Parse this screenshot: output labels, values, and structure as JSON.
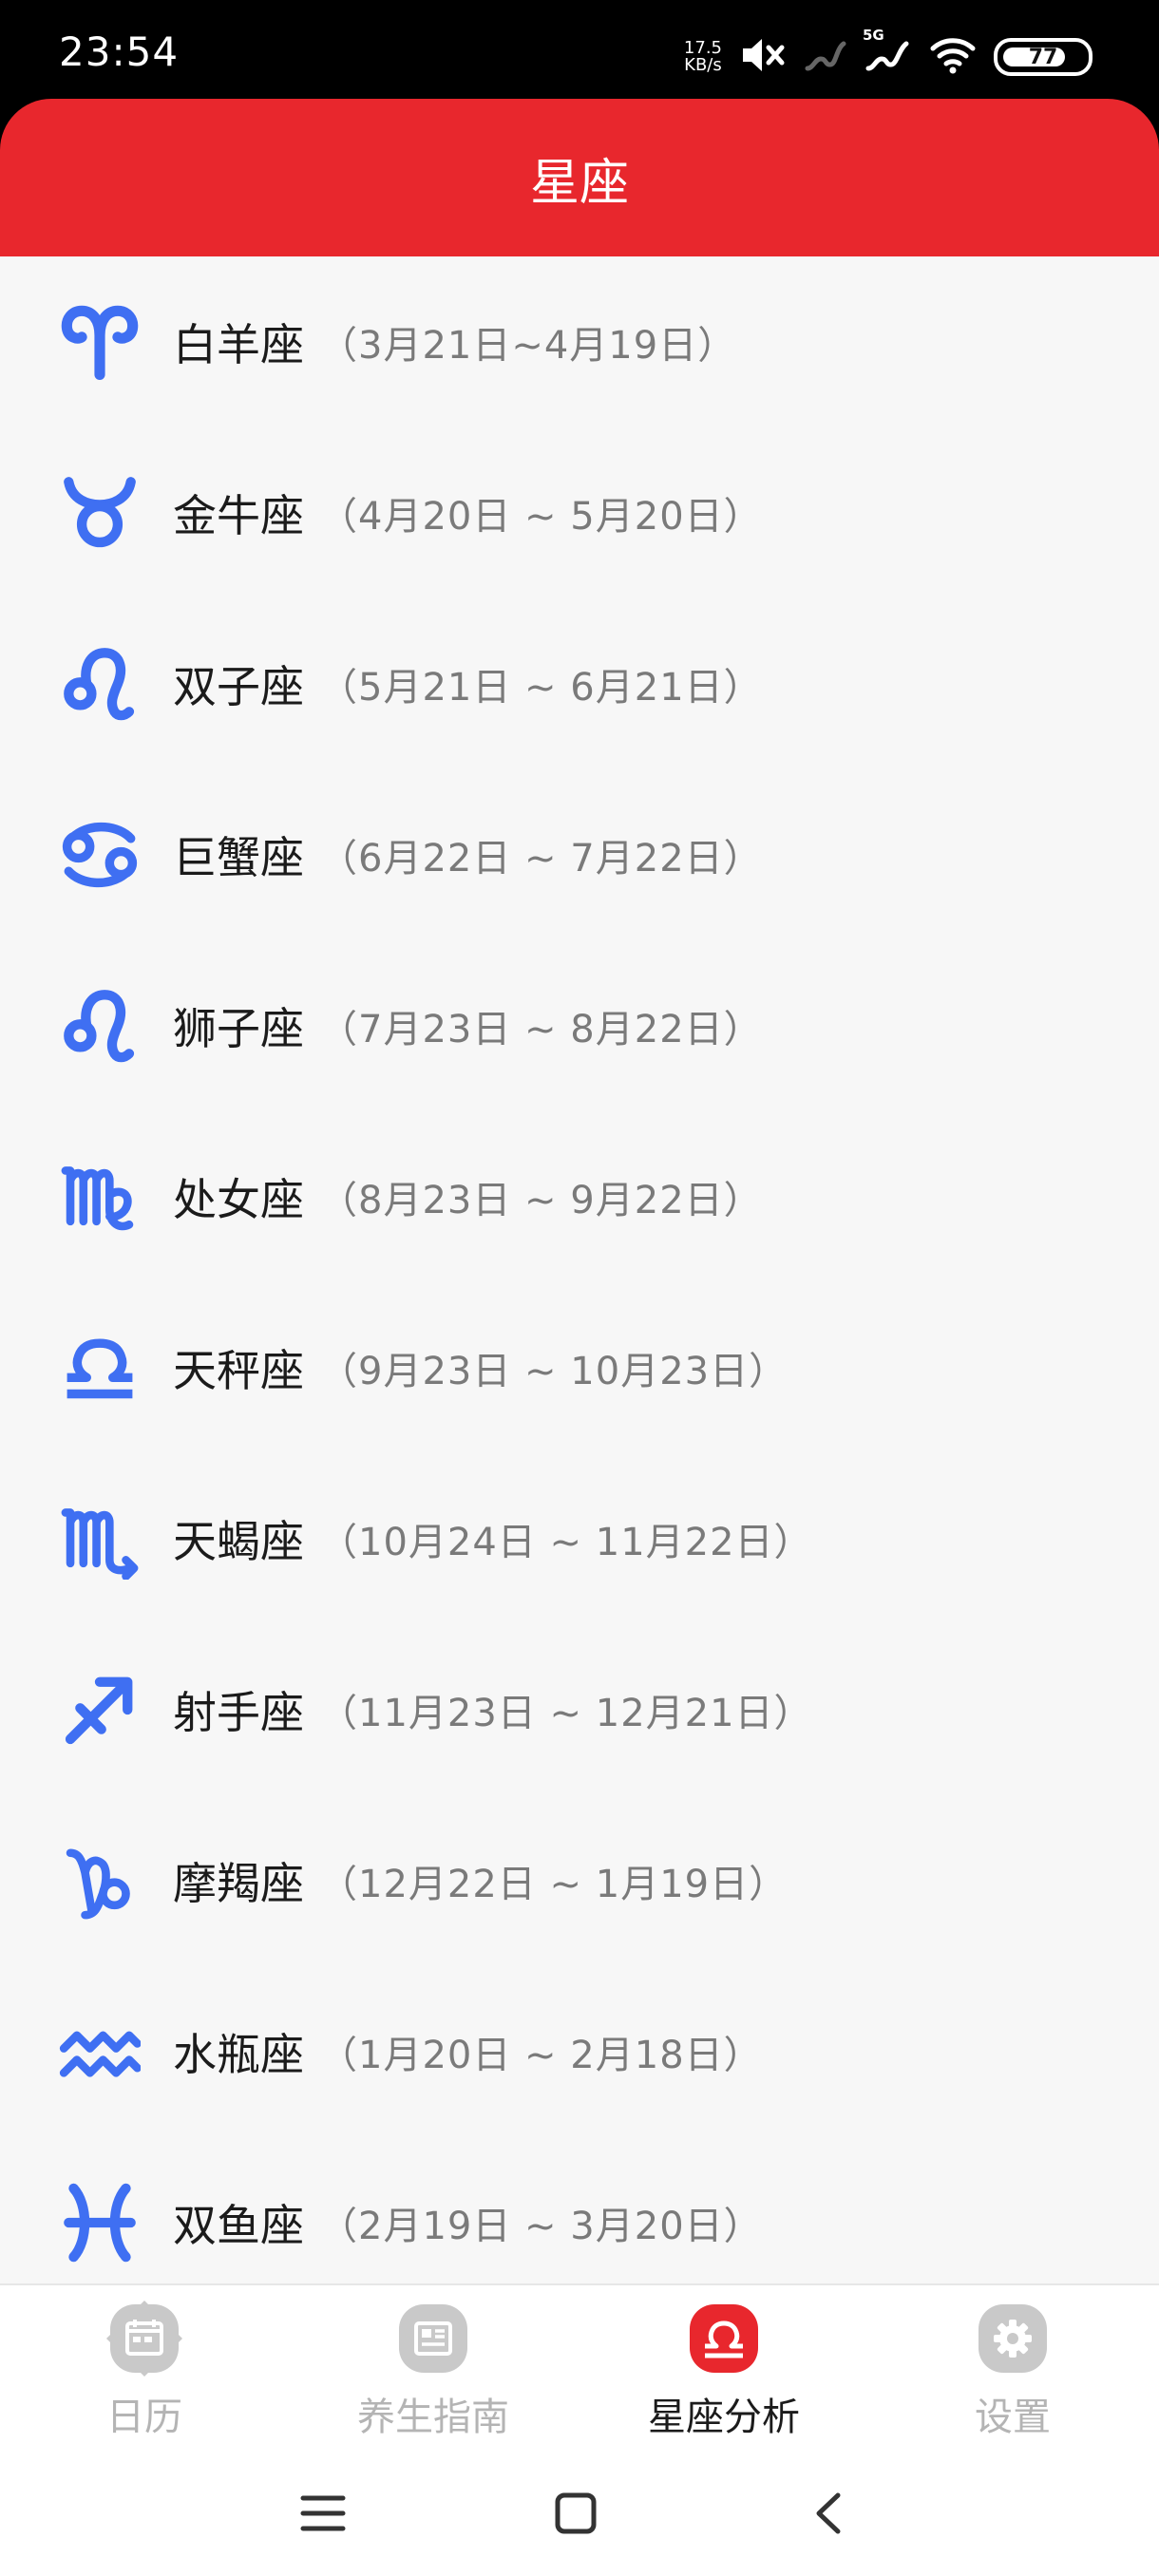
{
  "status_bar": {
    "time": "23:54",
    "net_speed_value": "17.5",
    "net_speed_unit": "KB/s",
    "network_type": "5G",
    "battery_level": "77",
    "icons": [
      "mute-icon",
      "signal-icon",
      "signal-5g-icon",
      "wifi-icon",
      "battery-icon"
    ]
  },
  "header": {
    "title": "星座"
  },
  "zodiac_list": [
    {
      "name": "白羊座",
      "dates": "（3月21日~4月19日）",
      "icon": "aries-icon"
    },
    {
      "name": "金牛座",
      "dates": "（4月20日 ~ 5月20日）",
      "icon": "taurus-icon"
    },
    {
      "name": "双子座",
      "dates": "（5月21日 ~ 6月21日）",
      "icon": "gemini-icon"
    },
    {
      "name": "巨蟹座",
      "dates": "（6月22日 ~ 7月22日）",
      "icon": "cancer-icon"
    },
    {
      "name": "狮子座",
      "dates": "（7月23日 ~ 8月22日）",
      "icon": "leo-icon"
    },
    {
      "name": "处女座",
      "dates": "（8月23日 ~ 9月22日）",
      "icon": "virgo-icon"
    },
    {
      "name": "天秤座",
      "dates": "（9月23日 ~ 10月23日）",
      "icon": "libra-icon"
    },
    {
      "name": "天蝎座",
      "dates": "（10月24日 ~ 11月22日）",
      "icon": "scorpio-icon"
    },
    {
      "name": "射手座",
      "dates": "（11月23日 ~ 12月21日）",
      "icon": "sagittarius-icon"
    },
    {
      "name": "摩羯座",
      "dates": "（12月22日 ~ 1月19日）",
      "icon": "capricorn-icon"
    },
    {
      "name": "水瓶座",
      "dates": "（1月20日 ~ 2月18日）",
      "icon": "aquarius-icon"
    },
    {
      "name": "双鱼座",
      "dates": "（2月19日 ~ 3月20日）",
      "icon": "pisces-icon"
    }
  ],
  "tabbar": {
    "tabs": [
      {
        "label": "日历",
        "icon": "calendar-icon",
        "active": false
      },
      {
        "label": "养生指南",
        "icon": "news-icon",
        "active": false
      },
      {
        "label": "星座分析",
        "icon": "libra-icon",
        "active": true
      },
      {
        "label": "设置",
        "icon": "gear-icon",
        "active": false
      }
    ]
  },
  "colors": {
    "brand_red": "#e8272d",
    "zodiac_blue": "#3f6ff2",
    "inactive_gray": "#c9c9c9",
    "list_background": "#f7f7f7"
  }
}
